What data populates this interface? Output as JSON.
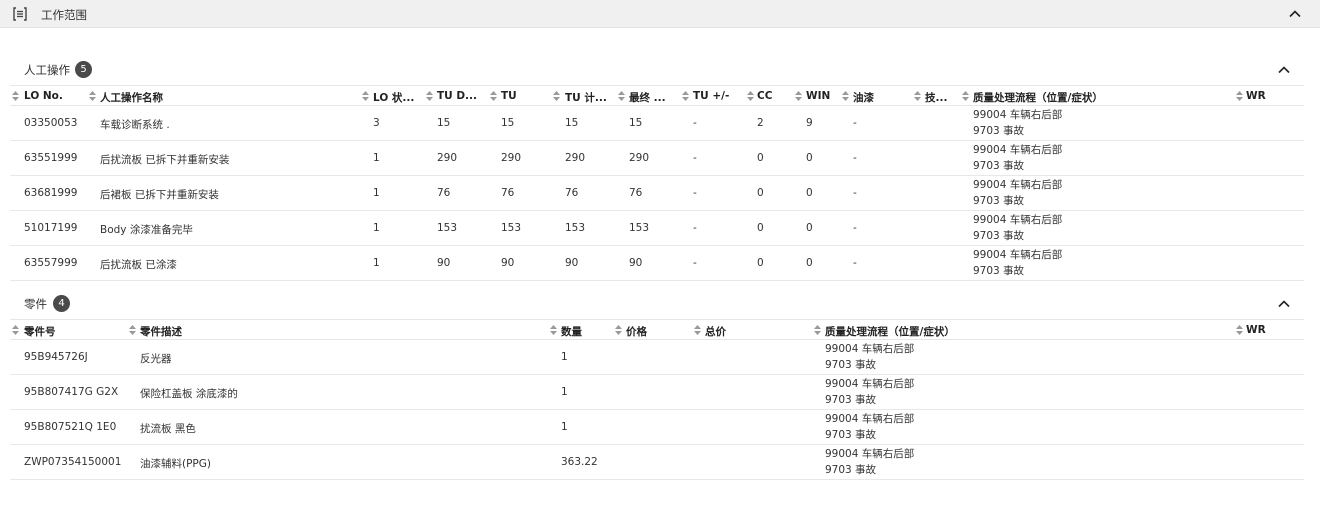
{
  "header": {
    "title": "工作范围"
  },
  "labor": {
    "title": "人工操作",
    "count": "5",
    "columns": [
      "LO No.",
      "人工操作名称",
      "LO 状...",
      "TU D...",
      "TU",
      "TU 计...",
      "最终 ...",
      "TU +/-",
      "CC",
      "WIN",
      "油漆",
      "技...",
      "质量处理流程（位置/症状）",
      "WR"
    ],
    "rows": [
      {
        "lo": "03350053",
        "name": "车载诊断系统 .",
        "status": "3",
        "tud": "15",
        "tu": "15",
        "tucalc": "15",
        "final": "15",
        "tupm": "-",
        "cc": "2",
        "win": "9",
        "paint": "-",
        "q1": "99004 车辆右后部",
        "q2": "9703 事故"
      },
      {
        "lo": "63551999",
        "name": "后扰流板 已拆下并重新安装",
        "status": "1",
        "tud": "290",
        "tu": "290",
        "tucalc": "290",
        "final": "290",
        "tupm": "-",
        "cc": "0",
        "win": "0",
        "paint": "-",
        "q1": "99004 车辆右后部",
        "q2": "9703 事故"
      },
      {
        "lo": "63681999",
        "name": "后裙板 已拆下并重新安装",
        "status": "1",
        "tud": "76",
        "tu": "76",
        "tucalc": "76",
        "final": "76",
        "tupm": "-",
        "cc": "0",
        "win": "0",
        "paint": "-",
        "q1": "99004 车辆右后部",
        "q2": "9703 事故"
      },
      {
        "lo": "51017199",
        "name": "Body 涂漆准备完毕",
        "status": "1",
        "tud": "153",
        "tu": "153",
        "tucalc": "153",
        "final": "153",
        "tupm": "-",
        "cc": "0",
        "win": "0",
        "paint": "-",
        "q1": "99004 车辆右后部",
        "q2": "9703 事故"
      },
      {
        "lo": "63557999",
        "name": "后扰流板 已涂漆",
        "status": "1",
        "tud": "90",
        "tu": "90",
        "tucalc": "90",
        "final": "90",
        "tupm": "-",
        "cc": "0",
        "win": "0",
        "paint": "-",
        "q1": "99004 车辆右后部",
        "q2": "9703 事故"
      }
    ]
  },
  "parts": {
    "title": "零件",
    "count": "4",
    "columns": [
      "零件号",
      "零件描述",
      "数量",
      "价格",
      "总价",
      "质量处理流程（位置/症状）",
      "WR"
    ],
    "rows": [
      {
        "no": "95B945726J",
        "desc": "反光器",
        "qty": "1",
        "price": "",
        "total": "",
        "q1": "99004 车辆右后部",
        "q2": "9703 事故"
      },
      {
        "no": "95B807417G G2X",
        "desc": "保险杠盖板 涂底漆的",
        "qty": "1",
        "price": "",
        "total": "",
        "q1": "99004 车辆右后部",
        "q2": "9703 事故"
      },
      {
        "no": "95B807521Q 1E0",
        "desc": "扰流板 黑色",
        "qty": "1",
        "price": "",
        "total": "",
        "q1": "99004 车辆右后部",
        "q2": "9703 事故"
      },
      {
        "no": "ZWP07354150001",
        "desc": "油漆辅料(PPG)",
        "qty": "363.22",
        "price": "",
        "total": "",
        "q1": "99004 车辆右后部",
        "q2": "9703 事故"
      }
    ]
  },
  "icons": {
    "header": "list-panel-icon",
    "collapse": "chevron-up-icon",
    "sort": "sort-arrows-icon"
  },
  "colors": {
    "header_bg": "#f0f0f0",
    "badge_bg": "#4a4a4a",
    "divider": "#e6e6e6"
  }
}
